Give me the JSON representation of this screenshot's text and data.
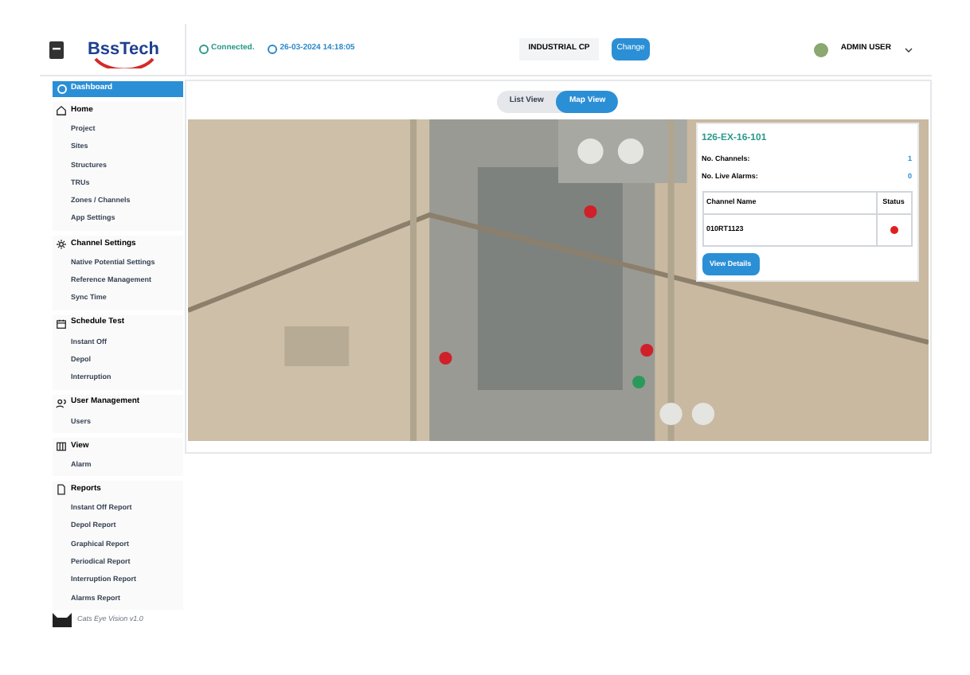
{
  "header": {
    "logo": "BssTech",
    "connection": "Connected.",
    "datetime": "26-03-2024 14:18:05",
    "project": "INDUSTRIAL CP",
    "change_button": "Change",
    "user": "ADMIN USER"
  },
  "sidebar": {
    "dashboard": {
      "label": "Dashboard",
      "selected": true
    },
    "groups": [
      {
        "label": "Home",
        "items": [
          "Project",
          "Sites",
          "Structures",
          "TRUs",
          "Zones / Channels",
          "App Settings"
        ]
      },
      {
        "label": "Channel Settings",
        "items": [
          "Native Potential Settings",
          "Reference Management",
          "Sync Time"
        ]
      },
      {
        "label": "Schedule Test",
        "items": [
          "Instant Off",
          "Depol",
          "Interruption"
        ]
      },
      {
        "label": "User Management",
        "items": [
          "Users"
        ]
      },
      {
        "label": "View",
        "items": [
          "Alarm"
        ]
      },
      {
        "label": "Reports",
        "items": [
          "Instant Off Report",
          "Depol Report",
          "Graphical Report",
          "Periodical Report",
          "Interruption Report",
          "Alarms Report"
        ]
      }
    ],
    "footer": "Cats Eye Vision v1.0"
  },
  "view_toggle": [
    {
      "label": "List View",
      "selected": false
    },
    {
      "label": "Map View",
      "selected": true
    }
  ],
  "map": {
    "popup": {
      "title": "126-EX-16-101",
      "stats": [
        {
          "label": "No. Channels:",
          "value": "1"
        },
        {
          "label": "No. Live Alarms:",
          "value": "0"
        }
      ],
      "columns": [
        "Channel Name",
        "Status"
      ],
      "rows": [
        {
          "channel": "010RT1123",
          "color": "#e02020"
        }
      ],
      "button": "View Details"
    }
  }
}
